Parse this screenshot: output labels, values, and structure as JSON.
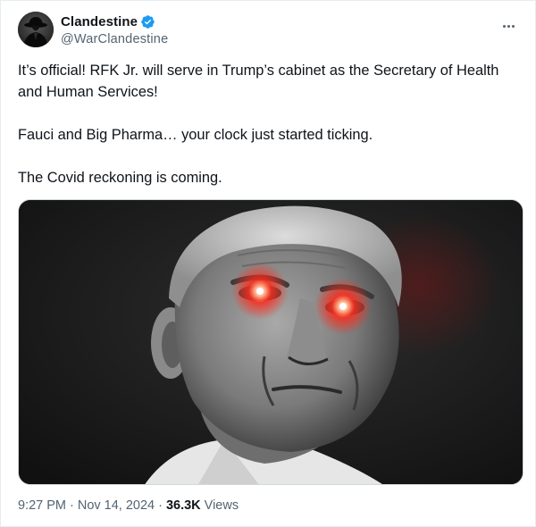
{
  "tweet": {
    "author": {
      "display_name": "Clandestine",
      "handle": "@WarClandestine",
      "verified": true,
      "avatar_icon": "spy-silhouette-icon",
      "verified_icon": "verified-badge-icon",
      "verified_color": "#1d9bf0"
    },
    "menu_icon": "more-options-icon",
    "paragraphs": [
      "It’s official! RFK Jr. will serve in Trump’s cabinet as the Secretary of Health and Human Services!",
      "Fauci and Big Pharma… your clock just started ticking.",
      "The Covid reckoning is coming."
    ],
    "media": {
      "kind": "photo",
      "subject": "portrait-photo",
      "accent": "#ff2a1a"
    },
    "meta": {
      "time": "9:27 PM",
      "separator": "·",
      "date": "Nov 14, 2024",
      "views_count": "36.3K",
      "views_label": "Views"
    },
    "colors": {
      "text": "#0f1419",
      "secondary": "#536471",
      "border": "#cfd9de"
    }
  }
}
